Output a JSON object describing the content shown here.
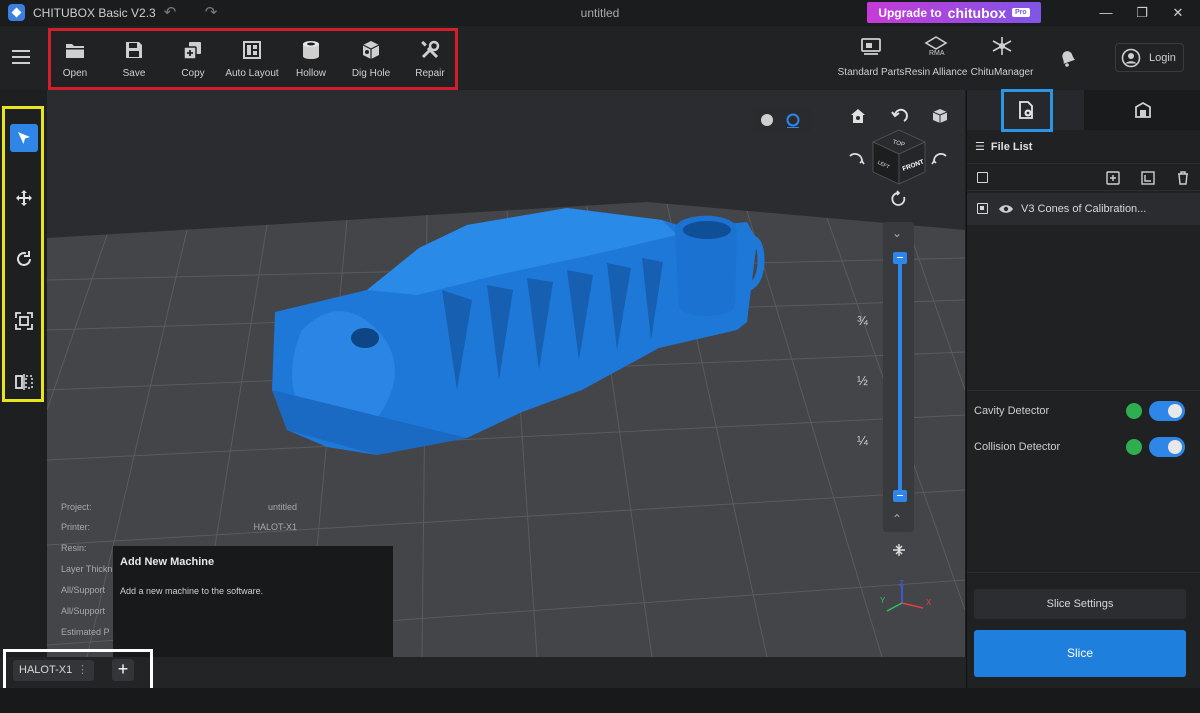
{
  "titlebar": {
    "app_title": "CHITUBOX Basic V2.3",
    "document_title": "untitled",
    "upgrade_label": "Upgrade to",
    "upgrade_brand": "chitubox",
    "upgrade_badge": "Pro"
  },
  "toolbar": {
    "tools": [
      {
        "label": "Open",
        "icon": "folder-icon"
      },
      {
        "label": "Save",
        "icon": "floppy-icon"
      },
      {
        "label": "Copy",
        "icon": "copy-icon"
      },
      {
        "label": "Auto Layout",
        "icon": "layout-icon"
      },
      {
        "label": "Hollow",
        "icon": "hollow-cylinder-icon"
      },
      {
        "label": "Dig Hole",
        "icon": "cube-hole-icon"
      },
      {
        "label": "Repair",
        "icon": "wrench-icon"
      }
    ],
    "right_tools": [
      {
        "label": "Standard Parts",
        "icon": "standard-parts-icon"
      },
      {
        "label": "Resin Alliance",
        "icon": "resin-alliance-icon"
      },
      {
        "label": "ChituManager",
        "icon": "chitumanager-icon"
      }
    ],
    "login_label": "Login"
  },
  "viewport": {
    "cube_labels": {
      "top": "TOP",
      "left": "LEFT",
      "front": "FRONT"
    },
    "slider_fractions": [
      "¾",
      "½",
      "¼"
    ],
    "info": [
      {
        "key": "Project:",
        "value": "untitled"
      },
      {
        "key": "Printer:",
        "value": "HALOT-X1"
      },
      {
        "key": "Resin:",
        "value": ""
      },
      {
        "key": "Layer Thickn",
        "value": ""
      },
      {
        "key": "All/Support",
        "value": ""
      },
      {
        "key": "All/Support",
        "value": ""
      },
      {
        "key": "Estimated P",
        "value": ""
      }
    ],
    "tooltip": {
      "title": "Add New Machine",
      "body": "Add a new machine to the software."
    },
    "axes": {
      "x": "X",
      "y": "Y",
      "z": "Z"
    }
  },
  "bottom": {
    "machine_tab": "HALOT-X1",
    "add_label": "+"
  },
  "right_panel": {
    "file_list_title": "File List",
    "files": [
      {
        "name": "V3 Cones of Calibration..."
      }
    ],
    "cavity_detector": "Cavity Detector",
    "collision_detector": "Collision Detector",
    "cavity_enabled": true,
    "collision_enabled": true,
    "slice_settings_label": "Slice Settings",
    "slice_label": "Slice"
  },
  "colors": {
    "accent": "#2e87e8",
    "model": "#1e78d8",
    "highlight_red": "#d11f2b",
    "highlight_yellow": "#e8e51e",
    "highlight_blue": "#2d95e6"
  }
}
